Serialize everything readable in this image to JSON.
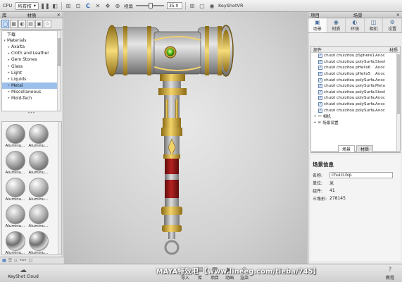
{
  "toolbar": {
    "cpu_label": "CPU",
    "cpu_mode": "所有核",
    "fov_label": "视角",
    "fov_value": "35.0",
    "keyshotvr_label": "KeyShotVR"
  },
  "left_panel": {
    "title": "材质",
    "left_stub": "库",
    "close": "×",
    "tree_root": "下载",
    "tree_items": [
      {
        "label": "Materials",
        "expanded": true,
        "indent": 0
      },
      {
        "label": "Axalta",
        "indent": 1
      },
      {
        "label": "Cloth and Leather",
        "indent": 1
      },
      {
        "label": "Gem Stones",
        "indent": 1
      },
      {
        "label": "Glass",
        "indent": 1
      },
      {
        "label": "Light",
        "indent": 1
      },
      {
        "label": "Liquids",
        "indent": 1
      },
      {
        "label": "Metal",
        "indent": 1,
        "selected": true
      },
      {
        "label": "Miscellaneous",
        "indent": 1
      },
      {
        "label": "Mold-Tech",
        "indent": 1
      }
    ],
    "thumbnails": [
      {
        "label": "Aluminu...",
        "style": "rough"
      },
      {
        "label": "Aluminu...",
        "style": "dots"
      },
      {
        "label": "Aluminu...",
        "style": "rough"
      },
      {
        "label": "Aluminu...",
        "style": "rough"
      },
      {
        "label": "Aluminu...",
        "style": "smooth"
      },
      {
        "label": "Aluminu...",
        "style": "smooth"
      },
      {
        "label": "Aluminu...",
        "style": "satin"
      },
      {
        "label": "Aluminu...",
        "style": "satin"
      },
      {
        "label": "Aluminu...",
        "style": "mirror"
      },
      {
        "label": "Aluminu...",
        "style": "mirror"
      },
      {
        "label": "Aluminu...",
        "style": "dark"
      },
      {
        "label": "Aluminu...",
        "style": "dark"
      }
    ]
  },
  "right_panel": {
    "project_label": "项目",
    "title": "场景",
    "close": "×",
    "tabs": [
      {
        "label": "场景",
        "icon": "▣",
        "active": true
      },
      {
        "label": "材质",
        "icon": "◉"
      },
      {
        "label": "环境",
        "icon": "◐"
      },
      {
        "label": "相机",
        "icon": "◫"
      },
      {
        "label": "设置",
        "icon": "⚙"
      }
    ],
    "tree_header_parts": "部件",
    "tree_header_material": "材质",
    "parts": [
      {
        "name": "chuizi chuizitou pSphere11",
        "mat": "Anoc"
      },
      {
        "name": "chuizi chuizitou polySurfa...",
        "mat": "Steel"
      },
      {
        "name": "chuizi chuizitou pHelix6",
        "mat": "Anoc"
      },
      {
        "name": "chuizi chuizitou pHelix5",
        "mat": "Anoc"
      },
      {
        "name": "chuizi chuizitou polySurfa...",
        "mat": "Anoc"
      },
      {
        "name": "chuizi chuizitou polySurfa...",
        "mat": "Meta"
      },
      {
        "name": "chuizi chuizitou polySurfa...",
        "mat": "Steel"
      },
      {
        "name": "chuizi chuizitou polySurfa...",
        "mat": "Anoc"
      },
      {
        "name": "chuizi chuizitou polySurfa...",
        "mat": "Anoc"
      },
      {
        "name": "chuizi chuizitou polySurfa...",
        "mat": "Anoc"
      }
    ],
    "groups": [
      {
        "label": "相机",
        "icon": "+ ▭"
      },
      {
        "label": "场景设置",
        "icon": "+ ≡"
      }
    ],
    "sub_tabs": [
      {
        "label": "场景",
        "active": true
      },
      {
        "label": "材质"
      }
    ],
    "info": {
      "title": "场景信息",
      "name_label": "名称:",
      "name_value": "chuizi.bip",
      "unit_label": "单位:",
      "unit_value": "米",
      "parts_label": "组件:",
      "parts_value": "41",
      "tri_label": "三角形:",
      "tri_value": "278145"
    }
  },
  "bottom_bar": {
    "cloud_label": "KeyShot Cloud",
    "buttons": [
      {
        "label": "导入",
        "icon": "⤓"
      },
      {
        "label": "库",
        "icon": "▤"
      },
      {
        "label": "项目",
        "icon": "▦"
      },
      {
        "label": "动画",
        "icon": "▶"
      },
      {
        "label": "渲染",
        "icon": "◎"
      }
    ],
    "help_label": "教程",
    "watermark": "MAYA特效吧 【www.lineeg.com/tieba/745】"
  }
}
